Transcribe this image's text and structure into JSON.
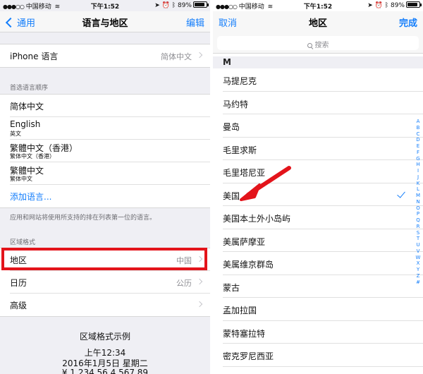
{
  "status_bar": {
    "carrier": "中国移动",
    "time": "下午1:52",
    "battery": "89%",
    "battery_level": 0.89
  },
  "left": {
    "nav": {
      "back_label": "通用",
      "title": "语言与地区",
      "edit_label": "编辑"
    },
    "iphone_language": {
      "label": "iPhone 语言",
      "value": "简体中文"
    },
    "preferred_header": "首选语言顺序",
    "languages": [
      {
        "name": "简体中文",
        "sub": ""
      },
      {
        "name": "English",
        "sub": "英文"
      },
      {
        "name": "繁體中文（香港）",
        "sub": "繁体中文（香港）"
      },
      {
        "name": "繁體中文",
        "sub": "繁体中文"
      }
    ],
    "add_language": "添加语言...",
    "footnote": "应用和网站将使用所支持的排在列表第一位的语言。",
    "region_format_header": "区域格式",
    "region": {
      "label": "地区",
      "value": "中国"
    },
    "calendar": {
      "label": "日历",
      "value": "公历"
    },
    "advanced": {
      "label": "高级"
    },
    "example": {
      "title": "区域格式示例",
      "time": "上午12:34",
      "date": "2016年1月5日 星期二",
      "numbers": "¥ 1,234.56   4,567.89"
    },
    "highlight_color": "#e3141b"
  },
  "right": {
    "nav": {
      "cancel_label": "取消",
      "title": "地区",
      "done_label": "完成"
    },
    "search_placeholder": "搜索",
    "section_letter": "M",
    "regions": [
      "马提尼克",
      "马约特",
      "曼岛",
      "毛里求斯",
      "毛里塔尼亚",
      "美国",
      "美国本土外小岛屿",
      "美属萨摩亚",
      "美属维京群岛",
      "蒙古",
      "孟加拉国",
      "蒙特塞拉特",
      "密克罗尼西亚"
    ],
    "selected_region": "美国",
    "index_letters": [
      "A",
      "B",
      "C",
      "D",
      "E",
      "F",
      "G",
      "H",
      "I",
      "J",
      "K",
      "L",
      "M",
      "N",
      "O",
      "P",
      "Q",
      "R",
      "S",
      "T",
      "U",
      "V",
      "W",
      "X",
      "Y",
      "Z",
      "#"
    ],
    "arrow_color": "#e3141b"
  },
  "colors": {
    "accent": "#147efb",
    "annotation_red": "#e3141b"
  }
}
